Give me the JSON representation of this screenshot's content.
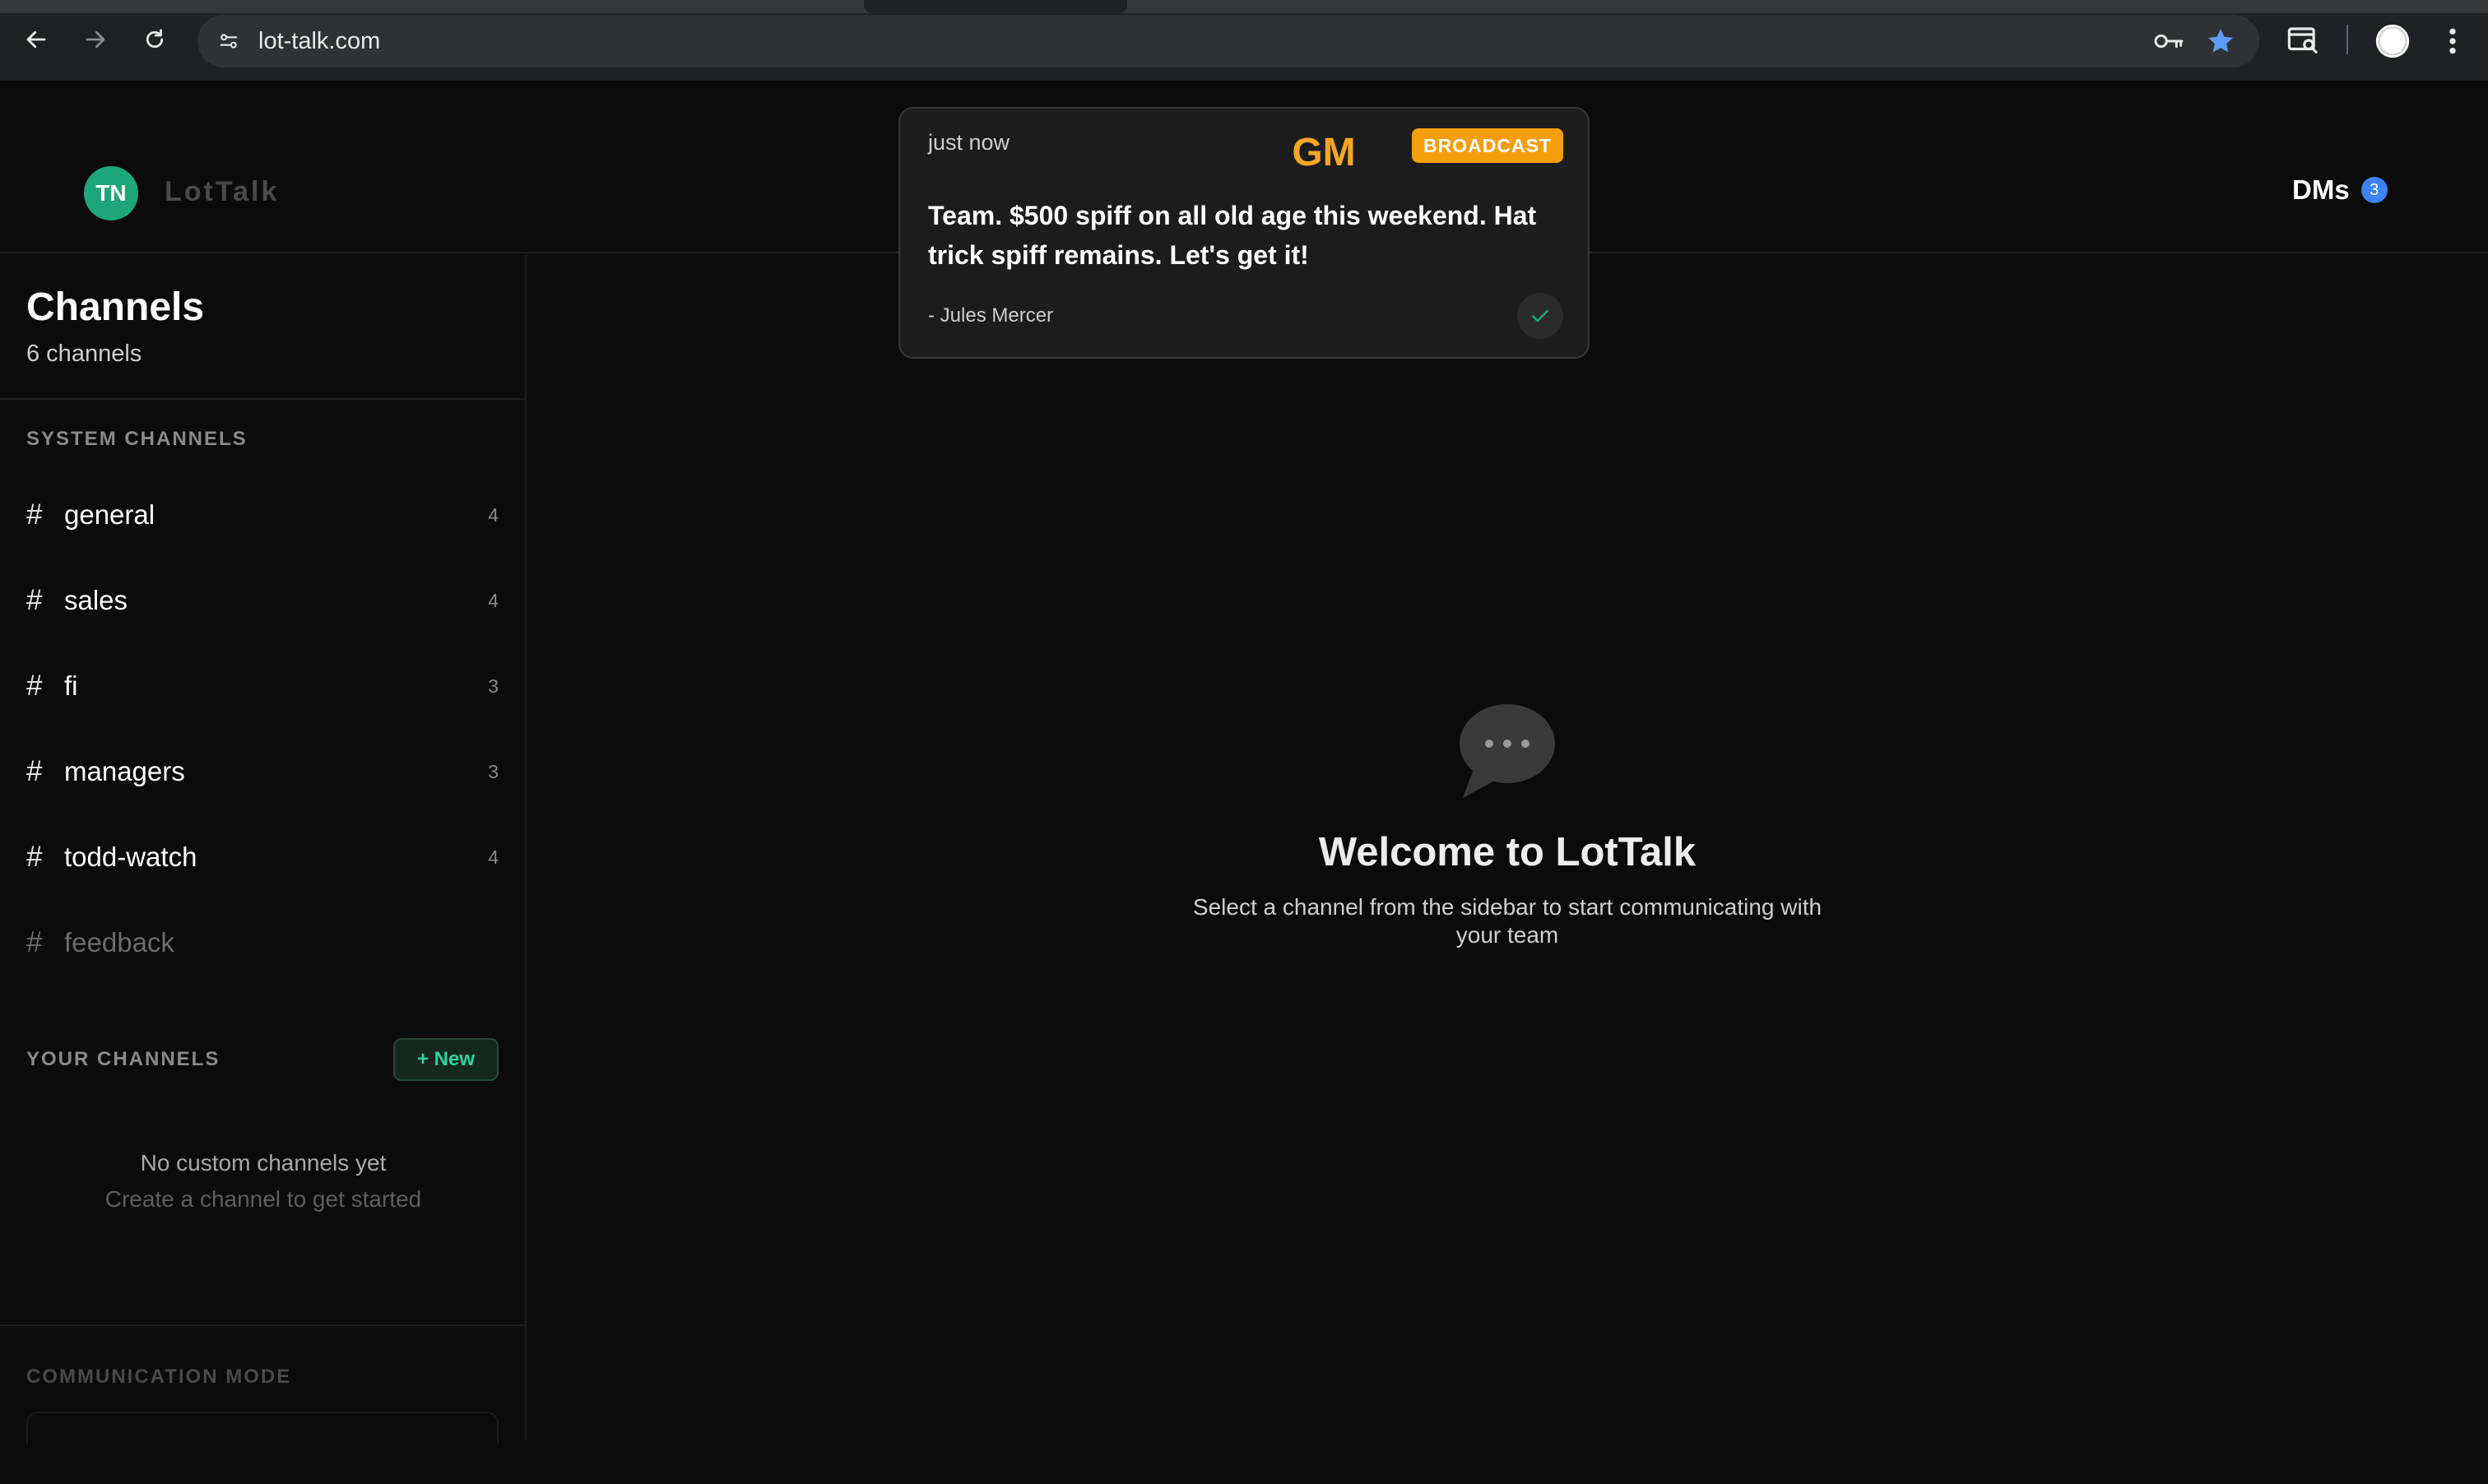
{
  "browser": {
    "url": "lot-talk.com"
  },
  "header": {
    "avatar_initials": "TN",
    "logo": "LotTalk",
    "dms_label": "DMs",
    "dms_count": "3"
  },
  "sidebar": {
    "title": "Channels",
    "subtitle": "6 channels",
    "system_label": "SYSTEM CHANNELS",
    "channels": [
      {
        "hash": "#",
        "name": "general",
        "count": "4"
      },
      {
        "hash": "#",
        "name": "sales",
        "count": "4"
      },
      {
        "hash": "#",
        "name": "fi",
        "count": "3"
      },
      {
        "hash": "#",
        "name": "managers",
        "count": "3"
      },
      {
        "hash": "#",
        "name": "todd-watch",
        "count": "4"
      },
      {
        "hash": "#",
        "name": "feedback",
        "count": ""
      }
    ],
    "your_label": "YOUR CHANNELS",
    "new_button": "+ New",
    "empty_title": "No custom channels yet",
    "empty_hint": "Create a channel to get started",
    "mode_label": "COMMUNICATION MODE"
  },
  "main": {
    "welcome_title": "Welcome to LotTalk",
    "welcome_subtitle": "Select a channel from the sidebar to start communicating with your team"
  },
  "toast": {
    "time": "just now",
    "sender_initials": "GM",
    "tag": "BROADCAST",
    "message": "Team.  $500 spiff on all old age this weekend.  Hat trick spiff remains.  Let's get it!",
    "sender": "- Jules Mercer"
  },
  "colors": {
    "background": "#0b0b0b",
    "accent_green": "#1fa57a",
    "broadcast_orange": "#f59e0b",
    "gm_orange": "#f5a623",
    "dm_badge_blue": "#3b82f6"
  }
}
